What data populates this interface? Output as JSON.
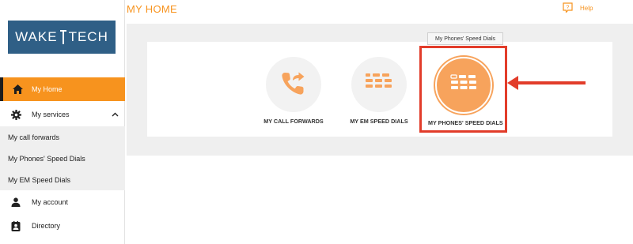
{
  "logo": {
    "text_left": "WAKE",
    "text_right": "TECH"
  },
  "header": {
    "title": "MY HOME",
    "help_label": "Help",
    "help_icon": "help-icon"
  },
  "sidebar": {
    "items": [
      {
        "label": "My Home",
        "icon": "home-icon"
      },
      {
        "label": "My services",
        "icon": "gear-icon"
      },
      {
        "label": "My call forwards"
      },
      {
        "label": "My Phones' Speed Dials"
      },
      {
        "label": "My EM Speed Dials"
      },
      {
        "label": "My account",
        "icon": "person-icon"
      },
      {
        "label": "Directory",
        "icon": "directory-icon"
      }
    ]
  },
  "tiles": [
    {
      "label": "MY CALL FORWARDS",
      "icon": "call-forward-icon"
    },
    {
      "label": "MY EM SPEED DIALS",
      "icon": "keypad-icon"
    },
    {
      "label": "MY PHONES' SPEED DIALS",
      "icon": "keypad-icon"
    }
  ],
  "tooltip": {
    "text": "My Phones' Speed Dials"
  },
  "colors": {
    "accent": "#f7931e",
    "annotation": "#e23c2a",
    "logo_bg": "#2f5f86"
  }
}
